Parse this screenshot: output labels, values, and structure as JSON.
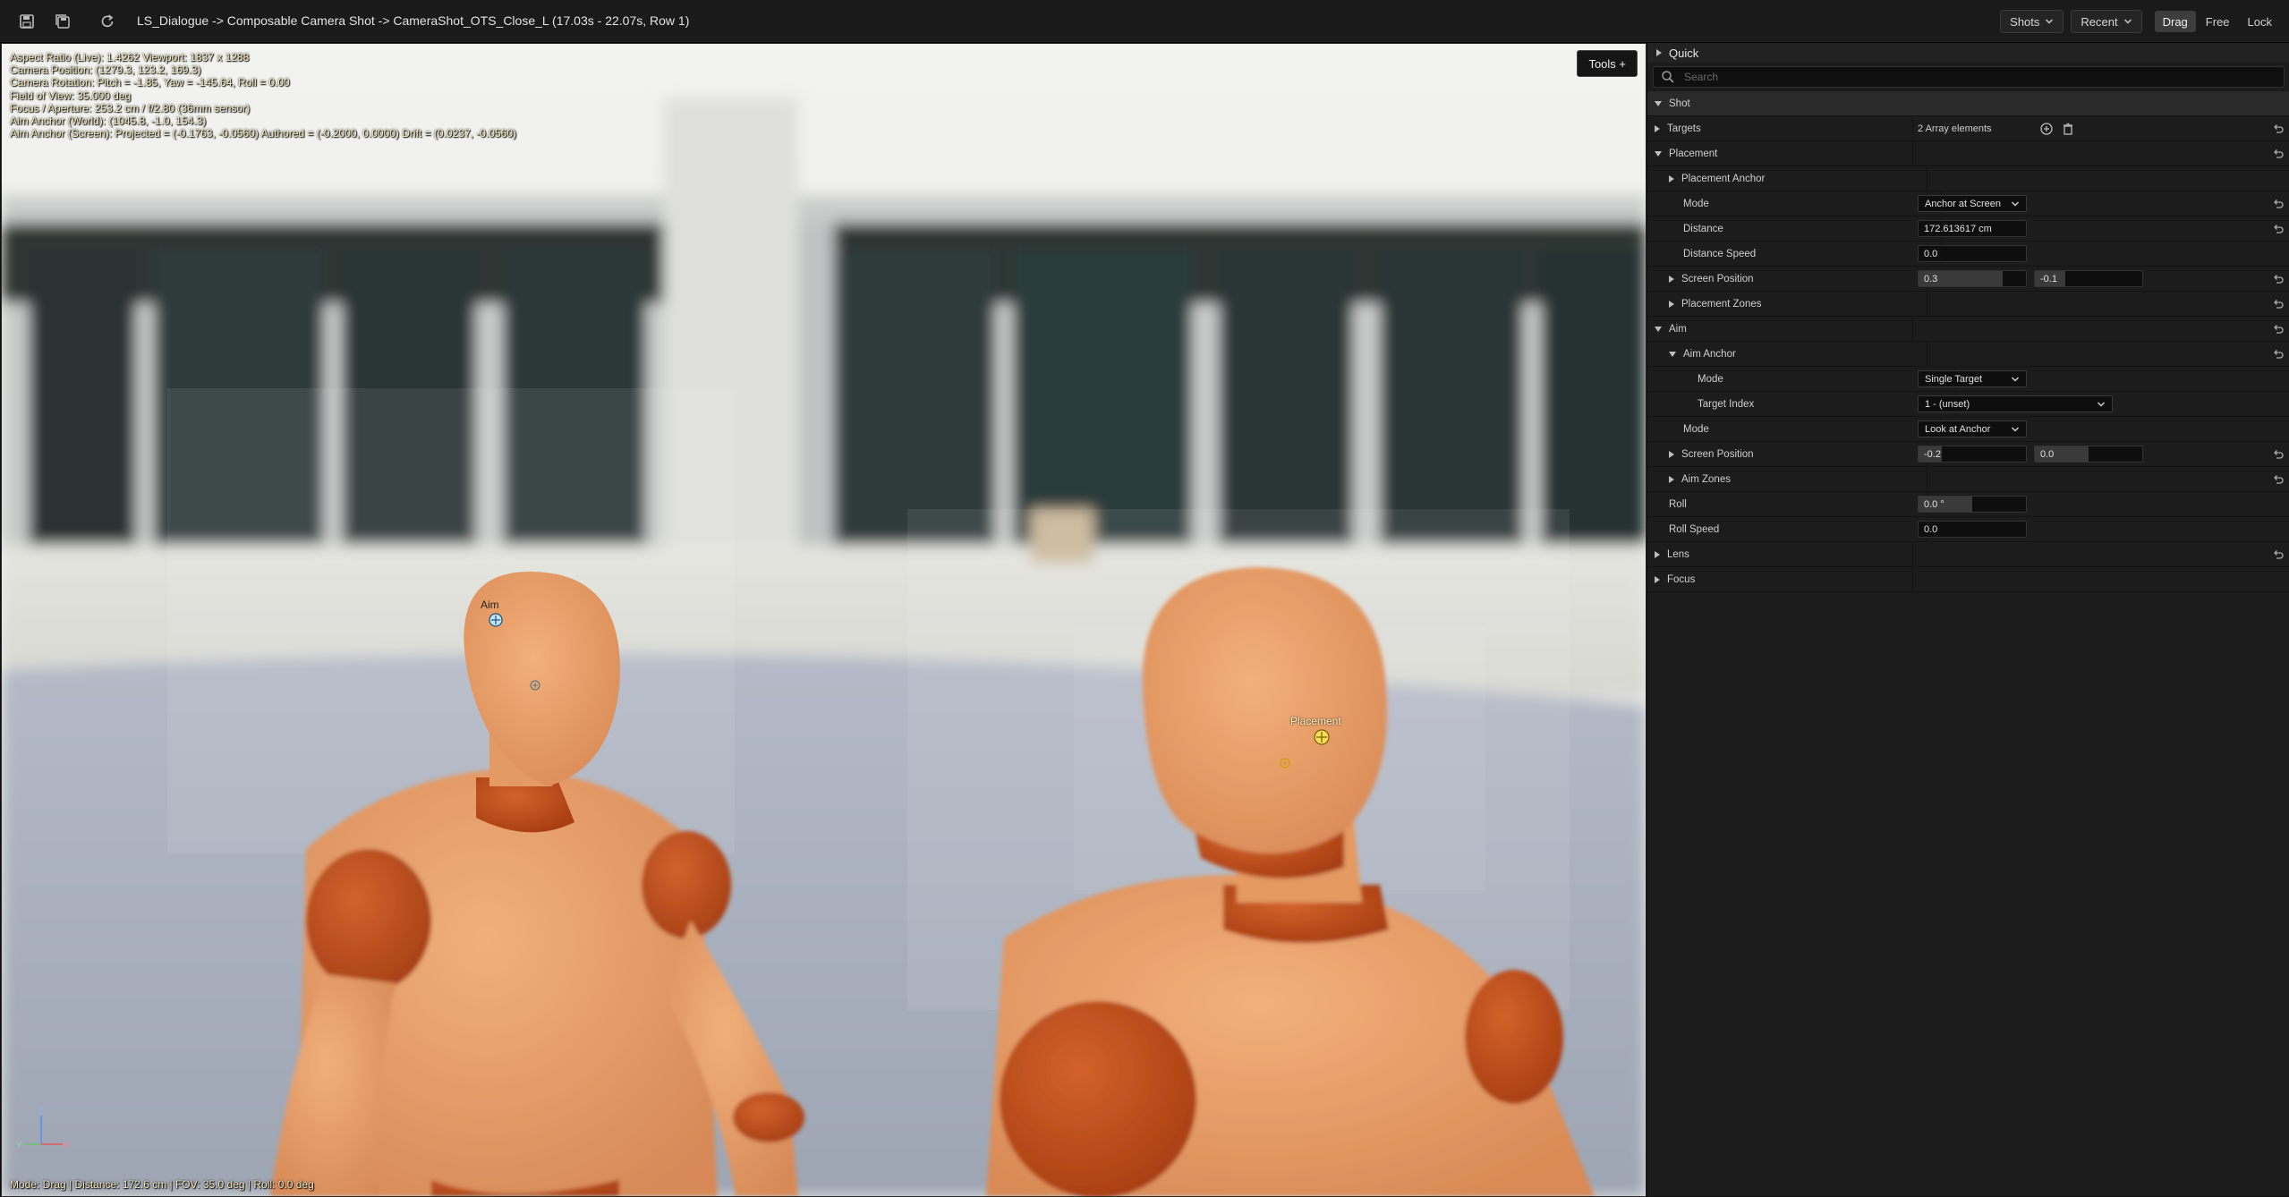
{
  "toolbar": {
    "title": "LS_Dialogue -> Composable Camera Shot -> CameraShot_OTS_Close_L (17.03s - 22.07s, Row 1)",
    "shots_label": "Shots",
    "recent_label": "Recent",
    "modes": [
      "Drag",
      "Free",
      "Lock"
    ],
    "active_mode": "Drag"
  },
  "viewport": {
    "overlay_lines": [
      "Aspect Ratio (Live): 1.4262 Viewport: 1837 x 1288",
      "Camera Position: (1279.3, 123.2, 169.3)",
      "Camera Rotation: Pitch = -1.85, Yaw = -145.64, Roll = 0.00",
      "Field of View: 35.000 deg",
      "Focus / Aperture: 253.2 cm / f/2.80 (36mm sensor)",
      "Aim Anchor (World): (1045.8, -1.0, 154.3)",
      "Aim Anchor (Screen): Projected = (-0.1763, -0.0560) Authored = (-0.2000, 0.0000) Drift = (0.0237, -0.0560)"
    ],
    "tools_label": "Tools +",
    "aim_marker_label": "Aim",
    "placement_marker_label": "Placement",
    "status": "Mode: Drag | Distance: 172.6 cm | FOV: 35.0 deg | Roll: 0.0 deg",
    "axis": {
      "z": "Z",
      "y": "Y",
      "x": "X"
    }
  },
  "panel": {
    "header": "Quick",
    "search_placeholder": "Search",
    "rows": {
      "shot": "Shot",
      "targets": "Targets",
      "targets_value": "2 Array elements",
      "placement": "Placement",
      "placement_anchor": "Placement Anchor",
      "placement_mode": "Mode",
      "placement_mode_value": "Anchor at Screen",
      "distance": "Distance",
      "distance_value": "172.613617 cm",
      "distance_speed": "Distance Speed",
      "distance_speed_value": "0.0",
      "placement_screen_position": "Screen Position",
      "placement_screen_x": "0.3",
      "placement_screen_y": "-0.1",
      "placement_zones": "Placement Zones",
      "aim": "Aim",
      "aim_anchor": "Aim Anchor",
      "aim_anchor_mode": "Mode",
      "aim_anchor_mode_value": "Single Target",
      "target_index": "Target Index",
      "target_index_value": "1 - (unset)",
      "aim_mode": "Mode",
      "aim_mode_value": "Look at Anchor",
      "aim_screen_position": "Screen Position",
      "aim_screen_x": "-0.2",
      "aim_screen_y": "0.0",
      "aim_zones": "Aim Zones",
      "roll": "Roll",
      "roll_value": "0.0 °",
      "roll_speed": "Roll Speed",
      "roll_speed_value": "0.0",
      "lens": "Lens",
      "focus": "Focus"
    }
  }
}
